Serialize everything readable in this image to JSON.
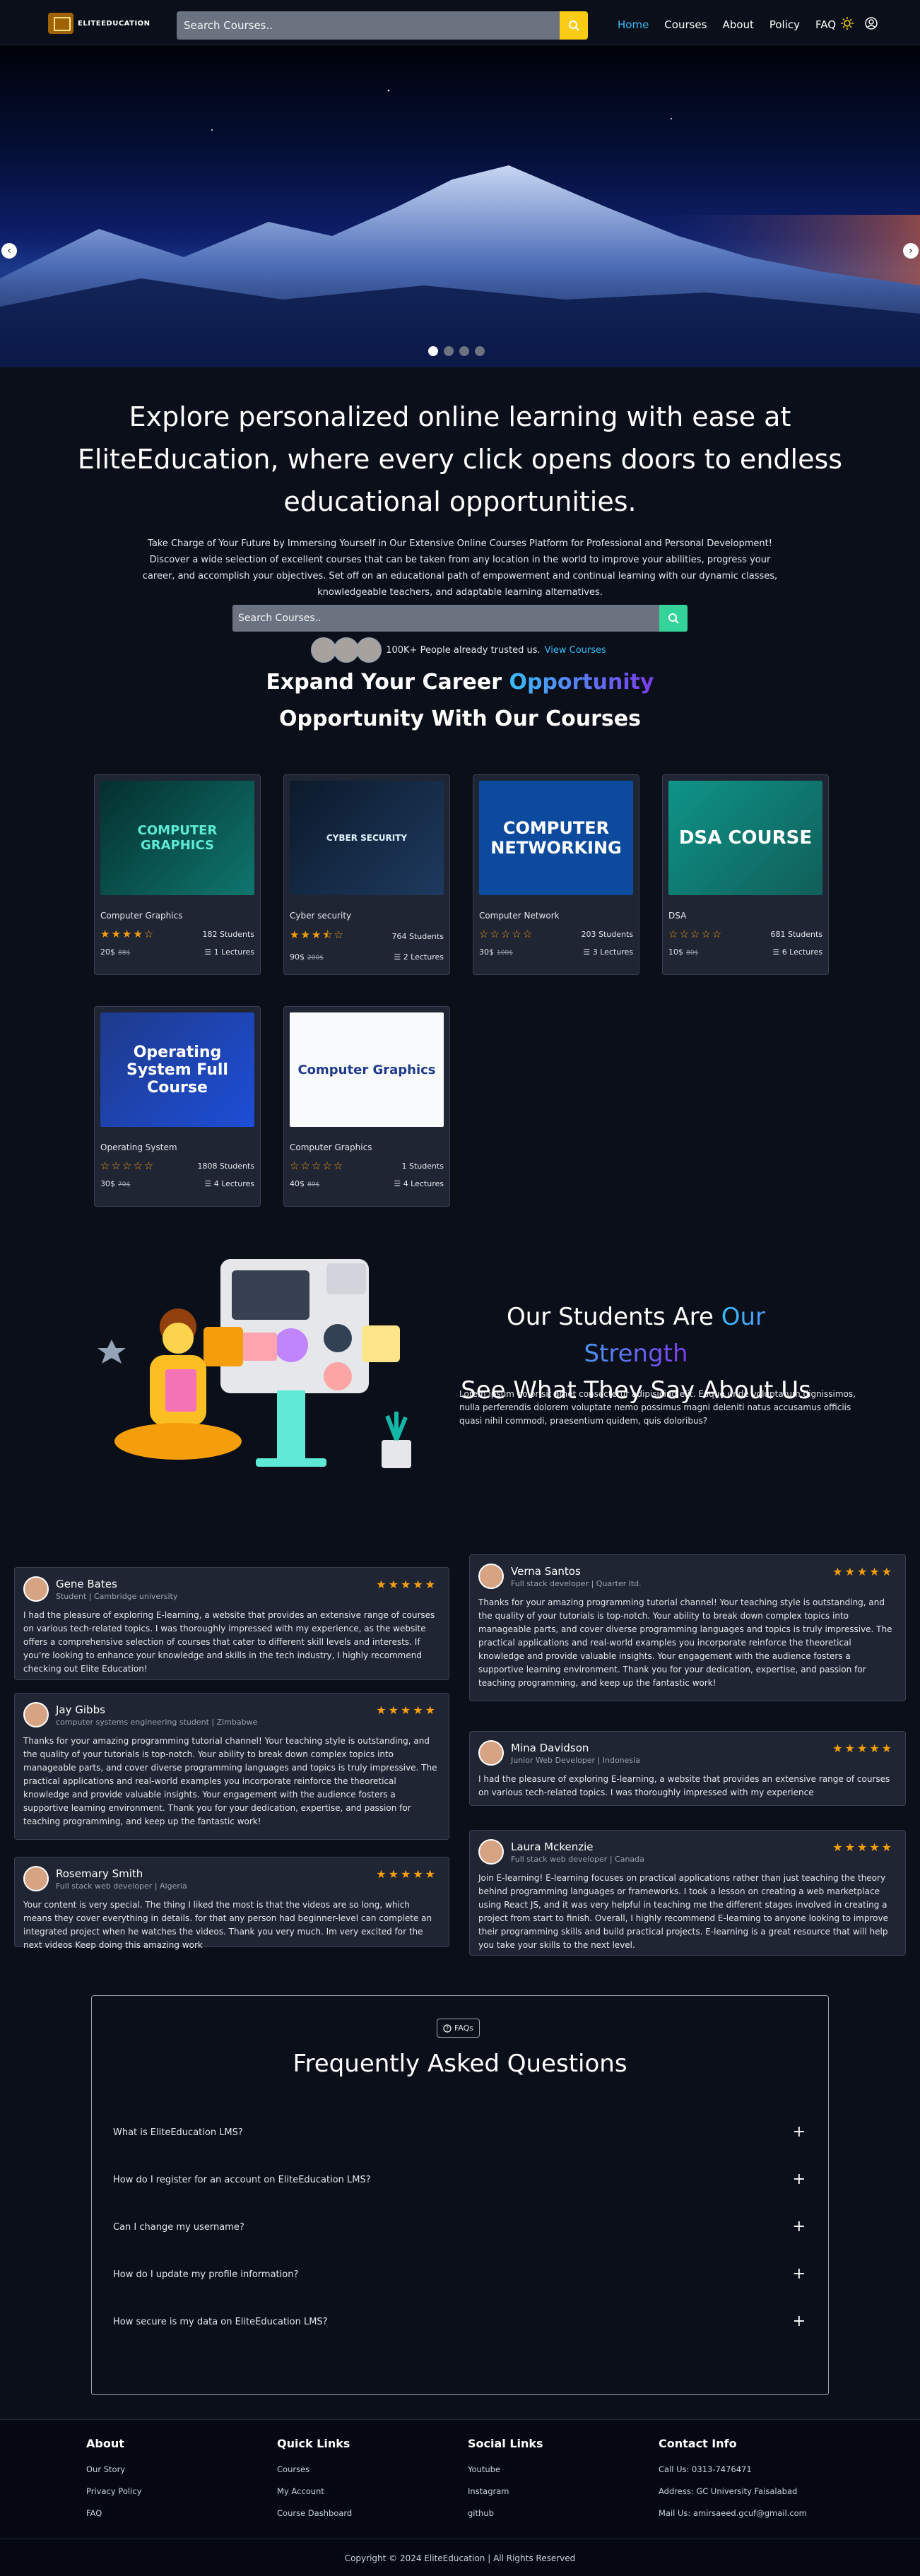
{
  "nav": {
    "logo_text": "ELITEEDUCATION",
    "search_placeholder": "Search Courses..",
    "links": [
      "Home",
      "Courses",
      "About",
      "Policy",
      "FAQ"
    ]
  },
  "hero": {
    "prev": "‹",
    "next": "›",
    "slide_count": 4,
    "active_slide": 1
  },
  "intro": {
    "heading": "Explore personalized online learning with ease at EliteEducation, where every click opens doors to endless educational opportunities.",
    "text": "Take Charge of Your Future by Immersing Yourself in Our Extensive Online Courses Platform for Professional and Personal Development! Discover a wide selection of excellent courses that can be taken from any location in the world to improve your abilities, progress your career, and accomplish your objectives. Set off on an educational path of empowerment and continual learning with our dynamic classes, knowledgeable teachers, and adaptable learning alternatives.",
    "search_placeholder": "Search Courses..",
    "trust_text": "100K+ People already trusted us.",
    "trust_link": "View Courses",
    "expand_a": "Expand Your Career ",
    "expand_hl": "Opportunity",
    "expand_b": "Opportunity With Our Courses"
  },
  "courses": [
    {
      "title": "Computer Graphics",
      "rating": 4,
      "students": "182 Students",
      "price": "20$",
      "old": "88$",
      "lectures": "1 Lectures",
      "thumb": "COMPUTER GRAPHICS"
    },
    {
      "title": "Cyber security",
      "rating": 3.5,
      "students": "764 Students",
      "price": "90$",
      "old": "200$",
      "lectures": "2 Lectures",
      "thumb": "CYBER SECURITY"
    },
    {
      "title": "Computer Network",
      "rating": 0,
      "students": "203 Students",
      "price": "30$",
      "old": "100$",
      "lectures": "3 Lectures",
      "thumb": "COMPUTER NETWORKING"
    },
    {
      "title": "DSA",
      "rating": 0,
      "students": "681 Students",
      "price": "10$",
      "old": "80$",
      "lectures": "6 Lectures",
      "thumb": "DSA COURSE"
    },
    {
      "title": "Operating System",
      "rating": 0,
      "students": "1808 Students",
      "price": "30$",
      "old": "70$",
      "lectures": "4 Lectures",
      "thumb": "Operating System Full Course"
    },
    {
      "title": "Computer Graphics",
      "rating": 0,
      "students": "1 Students",
      "price": "40$",
      "old": "80$",
      "lectures": "4 Lectures",
      "thumb": "Computer Graphics"
    }
  ],
  "testimonials": {
    "heading_a": "Our Students Are ",
    "heading_hl": "Our Strength",
    "heading_b": "See What They Say About Us",
    "lorem": "Lorem ipsum dolor sit amet consectetur adipisicing elit. Eaque unde voluptatum dignissimos, nulla perferendis dolorem voluptate nemo possimus magni deleniti natus accusamus officiis quasi nihil commodi, praesentium quidem, quis doloribus?",
    "stars": "★★★★★",
    "items": [
      {
        "name": "Gene Bates",
        "role": "Student | Cambridge university",
        "text": "I had the pleasure of exploring E-learning, a website that provides an extensive range of courses on various tech-related topics. I was thoroughly impressed with my experience, as the website offers a comprehensive selection of courses that cater to different skill levels and interests. If you're looking to enhance your knowledge and skills in the tech industry, I highly recommend checking out Elite Education!"
      },
      {
        "name": "Jay Gibbs",
        "role": "computer systems engineering student | Zimbabwe",
        "text": "Thanks for your amazing programming tutorial channel! Your teaching style is outstanding, and the quality of your tutorials is top-notch. Your ability to break down complex topics into manageable parts, and cover diverse programming languages and topics is truly impressive. The practical applications and real-world examples you incorporate reinforce the theoretical knowledge and provide valuable insights. Your engagement with the audience fosters a supportive learning environment. Thank you for your dedication, expertise, and passion for teaching programming, and keep up the fantastic work!"
      },
      {
        "name": "Rosemary Smith",
        "role": "Full stack web developer | Algeria",
        "text": "Your content is very special. The thing I liked the most is that the videos are so long, which means they cover everything in details. for that any person had beginner-level can complete an integrated project when he watches the videos. Thank you very much. Im very excited for the next videos Keep doing this amazing work"
      },
      {
        "name": "Verna Santos",
        "role": "Full stack developer | Quarter ltd.",
        "text": "Thanks for your amazing programming tutorial channel! Your teaching style is outstanding, and the quality of your tutorials is top-notch. Your ability to break down complex topics into manageable parts, and cover diverse programming languages and topics is truly impressive. The practical applications and real-world examples you incorporate reinforce the theoretical knowledge and provide valuable insights. Your engagement with the audience fosters a supportive learning environment. Thank you for your dedication, expertise, and passion for teaching programming, and keep up the fantastic work!"
      },
      {
        "name": "Mina Davidson",
        "role": "Junior Web Developer | Indonesia",
        "text": "I had the pleasure of exploring E-learning, a website that provides an extensive range of courses on various tech-related topics. I was thoroughly impressed with my experience"
      },
      {
        "name": "Laura Mckenzie",
        "role": "Full stack web developer | Canada",
        "text": "Join E-learning! E-learning focuses on practical applications rather than just teaching the theory behind programming languages or frameworks. I took a lesson on creating a web marketplace using React JS, and it was very helpful in teaching me the different stages involved in creating a project from start to finish. Overall, I highly recommend E-learning to anyone looking to improve their programming skills and build practical projects. E-learning is a great resource that will help you take your skills to the next level."
      }
    ]
  },
  "faq": {
    "badge": "FAQs",
    "heading": "Frequently Asked Questions",
    "plus": "+",
    "questions": [
      "What is EliteEducation LMS?",
      "How do I register for an account on EliteEducation LMS?",
      "Can I change my username?",
      "How do I update my profile information?",
      "How secure is my data on EliteEducation LMS?"
    ]
  },
  "footer": {
    "about": {
      "title": "About",
      "items": [
        "Our Story",
        "Privacy Policy",
        "FAQ"
      ]
    },
    "quick": {
      "title": "Quick Links",
      "items": [
        "Courses",
        "My Account",
        "Course Dashboard"
      ]
    },
    "social": {
      "title": "Social Links",
      "items": [
        "Youtube",
        "Instagram",
        "github"
      ]
    },
    "contact": {
      "title": "Contact Info",
      "items": [
        "Call Us: 0313-7476471",
        "Address: GC University Faisalabad",
        "Mail Us: amirsaeed.gcuf@gmail.com"
      ]
    },
    "copyright": "Copyright © 2024 EliteEducation | All Rights Reserved"
  }
}
